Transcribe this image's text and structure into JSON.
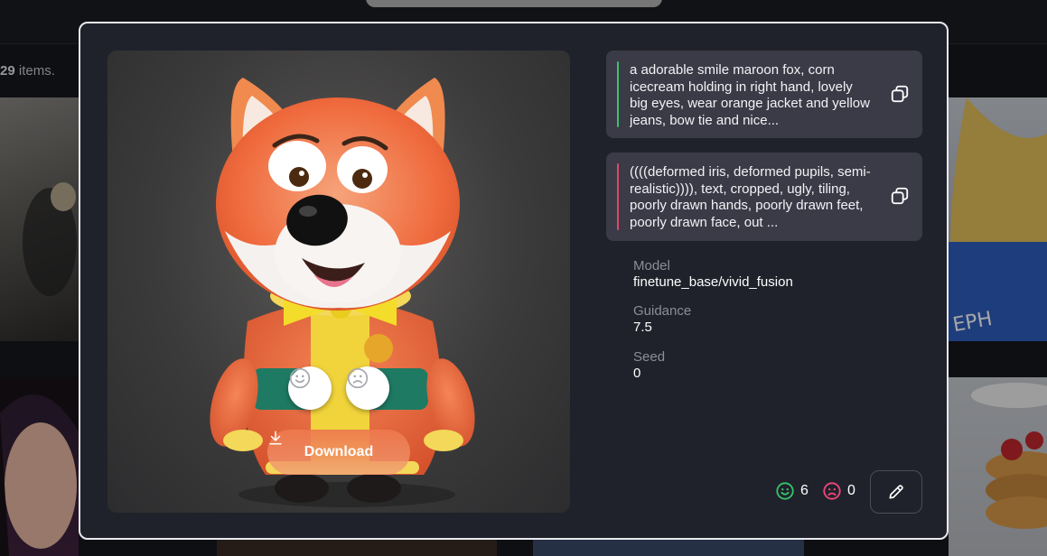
{
  "background": {
    "items_count_number": "29",
    "items_count_suffix": " items."
  },
  "preview": {
    "image_name": "orange-fox-character-image",
    "download_label": "Download",
    "like_icon": "smile-icon",
    "dislike_icon": "frown-icon"
  },
  "prompts": {
    "positive": {
      "text": "a adorable smile maroon fox, corn icecream holding in right hand, lovely big eyes, wear orange jacket and yellow jeans, bow tie and nice...",
      "accent": "#3fbf6a"
    },
    "negative": {
      "text": "((((deformed iris, deformed pupils, semi-realistic)))), text, cropped, ugly, tiling, poorly drawn hands, poorly drawn feet, poorly drawn face, out ...",
      "accent": "#e0476a"
    },
    "copy_icon": "copy-icon"
  },
  "details": {
    "model_label": "Model",
    "model_value": "finetune_base/vivid_fusion",
    "guidance_label": "Guidance",
    "guidance_value": "7.5",
    "seed_label": "Seed",
    "seed_value": "0"
  },
  "stats": {
    "likes": "6",
    "dislikes": "0",
    "like_color": "#34c46b",
    "dislike_color": "#f0467a"
  },
  "edit_icon": "pencil-icon"
}
